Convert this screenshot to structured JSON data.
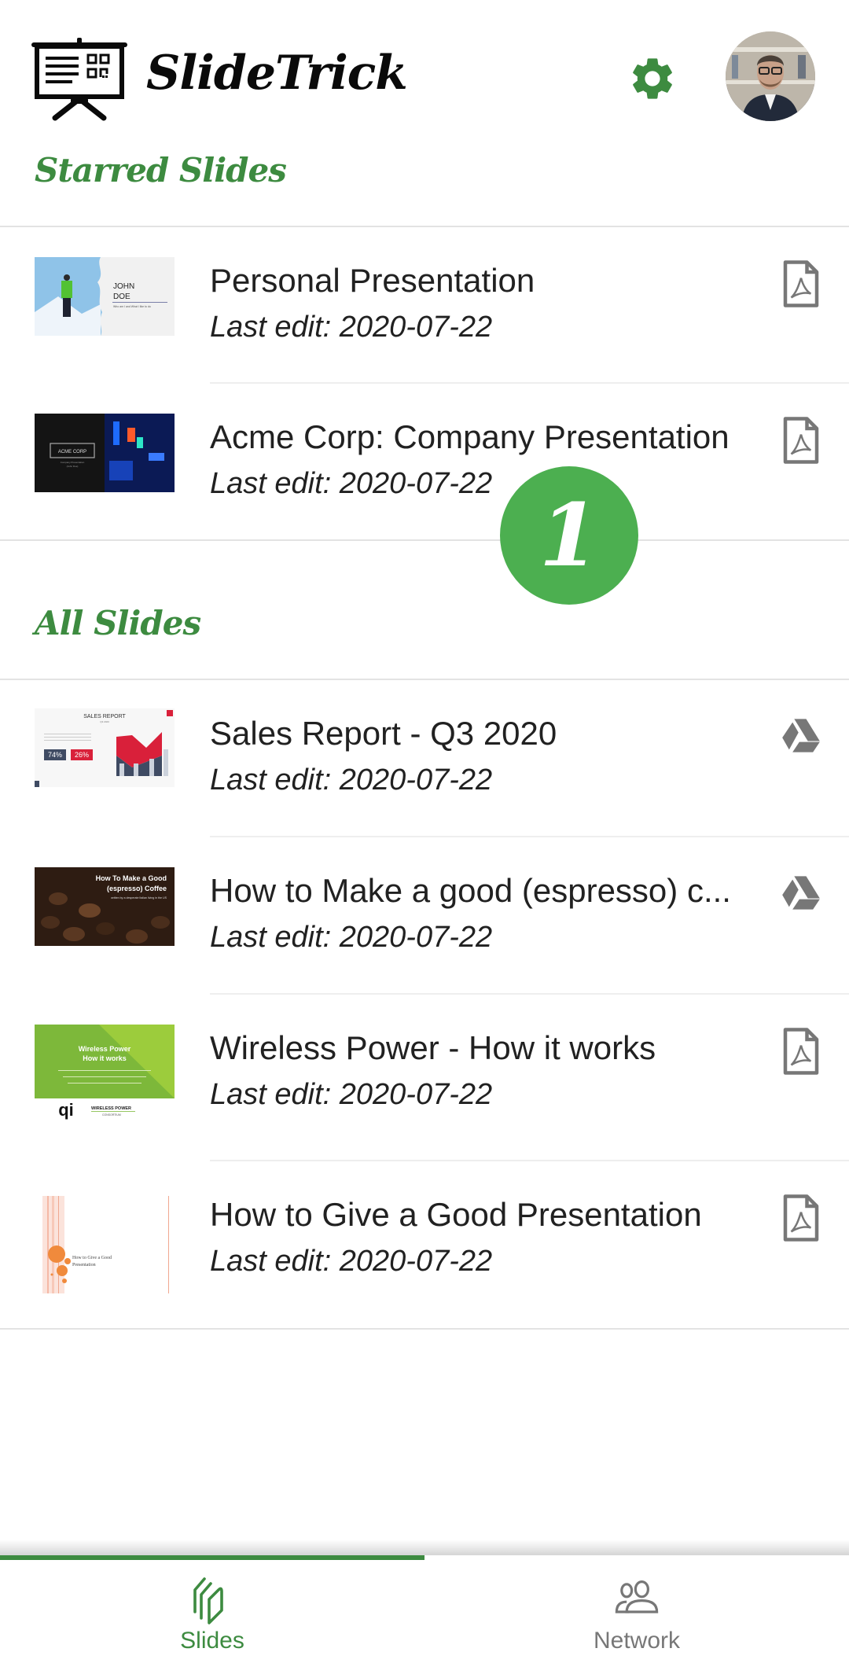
{
  "app": {
    "title": "SlideTrick",
    "logo_icon": "presentation-board-icon",
    "settings_icon": "gear-icon",
    "avatar_alt": "User profile photo",
    "accent_color": "#3d8b40",
    "badge_color": "#4caf50"
  },
  "sections": {
    "starred": {
      "title": "Starred Slides",
      "items": [
        {
          "title": "Personal Presentation",
          "subtitle": "Last edit: 2020-07-22",
          "source_icon": "pdf-icon",
          "thumb_text": [
            "JOHN",
            "DOE",
            "Who am I and What I like to do"
          ]
        },
        {
          "title": "Acme Corp: Company Presentation",
          "subtitle": "Last edit: 2020-07-22",
          "source_icon": "pdf-icon",
          "thumb_text": [
            "ACME CORP",
            "Company Presentation",
            "(John Doe)"
          ]
        }
      ]
    },
    "all": {
      "title": "All Slides",
      "items": [
        {
          "title": "Sales Report - Q3 2020",
          "subtitle": "Last edit: 2020-07-22",
          "source_icon": "google-drive-icon",
          "thumb_text": [
            "SALES REPORT",
            "Q3 2020",
            "74%",
            "26%"
          ]
        },
        {
          "title": "How to Make a good (espresso) c...",
          "subtitle": "Last edit: 2020-07-22",
          "source_icon": "google-drive-icon",
          "thumb_text": [
            "How To Make a Good",
            "(espresso) Coffee",
            "written by a desperate Italian living in the US"
          ]
        },
        {
          "title": "Wireless Power - How it works",
          "subtitle": "Last edit: 2020-07-22",
          "source_icon": "pdf-icon",
          "thumb_text": [
            "Wireless Power",
            "How it works",
            "WIRELESS POWER",
            "CONSORTIUM"
          ]
        },
        {
          "title": "How to Give a Good Presentation",
          "subtitle": "Last edit: 2020-07-22",
          "source_icon": "pdf-icon",
          "thumb_text": [
            "How to Give a Good",
            "Presentation"
          ]
        }
      ]
    }
  },
  "tutorial_badge": "1",
  "bottom_nav": {
    "tabs": [
      {
        "label": "Slides",
        "icon": "slides-stack-icon",
        "active": true
      },
      {
        "label": "Network",
        "icon": "people-icon",
        "active": false
      }
    ]
  }
}
